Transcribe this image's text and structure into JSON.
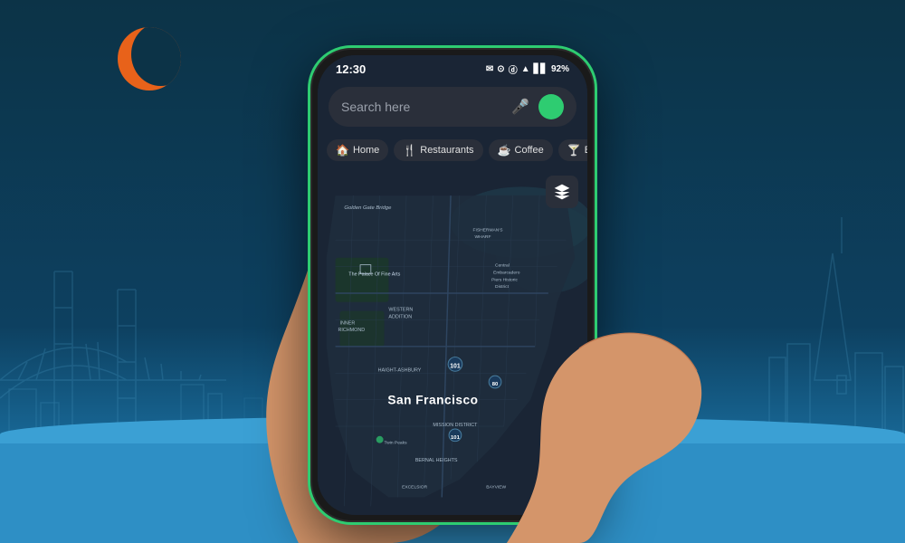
{
  "background": {
    "color_top": "#0c3347",
    "color_bottom": "#2e8fc5"
  },
  "moon": {
    "color": "#e8621a"
  },
  "phone": {
    "border_color": "#2ecc71",
    "status_bar": {
      "time": "12:30",
      "battery": "92%",
      "icons": "📧 📍 ⓓ 📶 📶"
    },
    "search": {
      "placeholder": "Search here",
      "mic_label": "mic-icon",
      "green_dot_color": "#2ecc71"
    },
    "chips": [
      {
        "icon": "🏠",
        "label": "Home"
      },
      {
        "icon": "🍴",
        "label": "Restaurants"
      },
      {
        "icon": "☕",
        "label": "Coffee"
      },
      {
        "icon": "🍸",
        "label": "B..."
      }
    ],
    "map": {
      "city": "San Francisco",
      "labels": [
        "Golden Gate Bridge",
        "The Palace Of Fine Arts",
        "FISHERMAN'S WHARF",
        "Central Embarcadero Piers Historic District",
        "INNER RICHMOND",
        "WESTERN ADDITION",
        "HAIGHT-ASHBURY",
        "Twin Peaks",
        "MISSION DISTRICT",
        "BERNAL HEIGHTS",
        "EXCELSIOR",
        "BAYVIEW"
      ]
    }
  }
}
